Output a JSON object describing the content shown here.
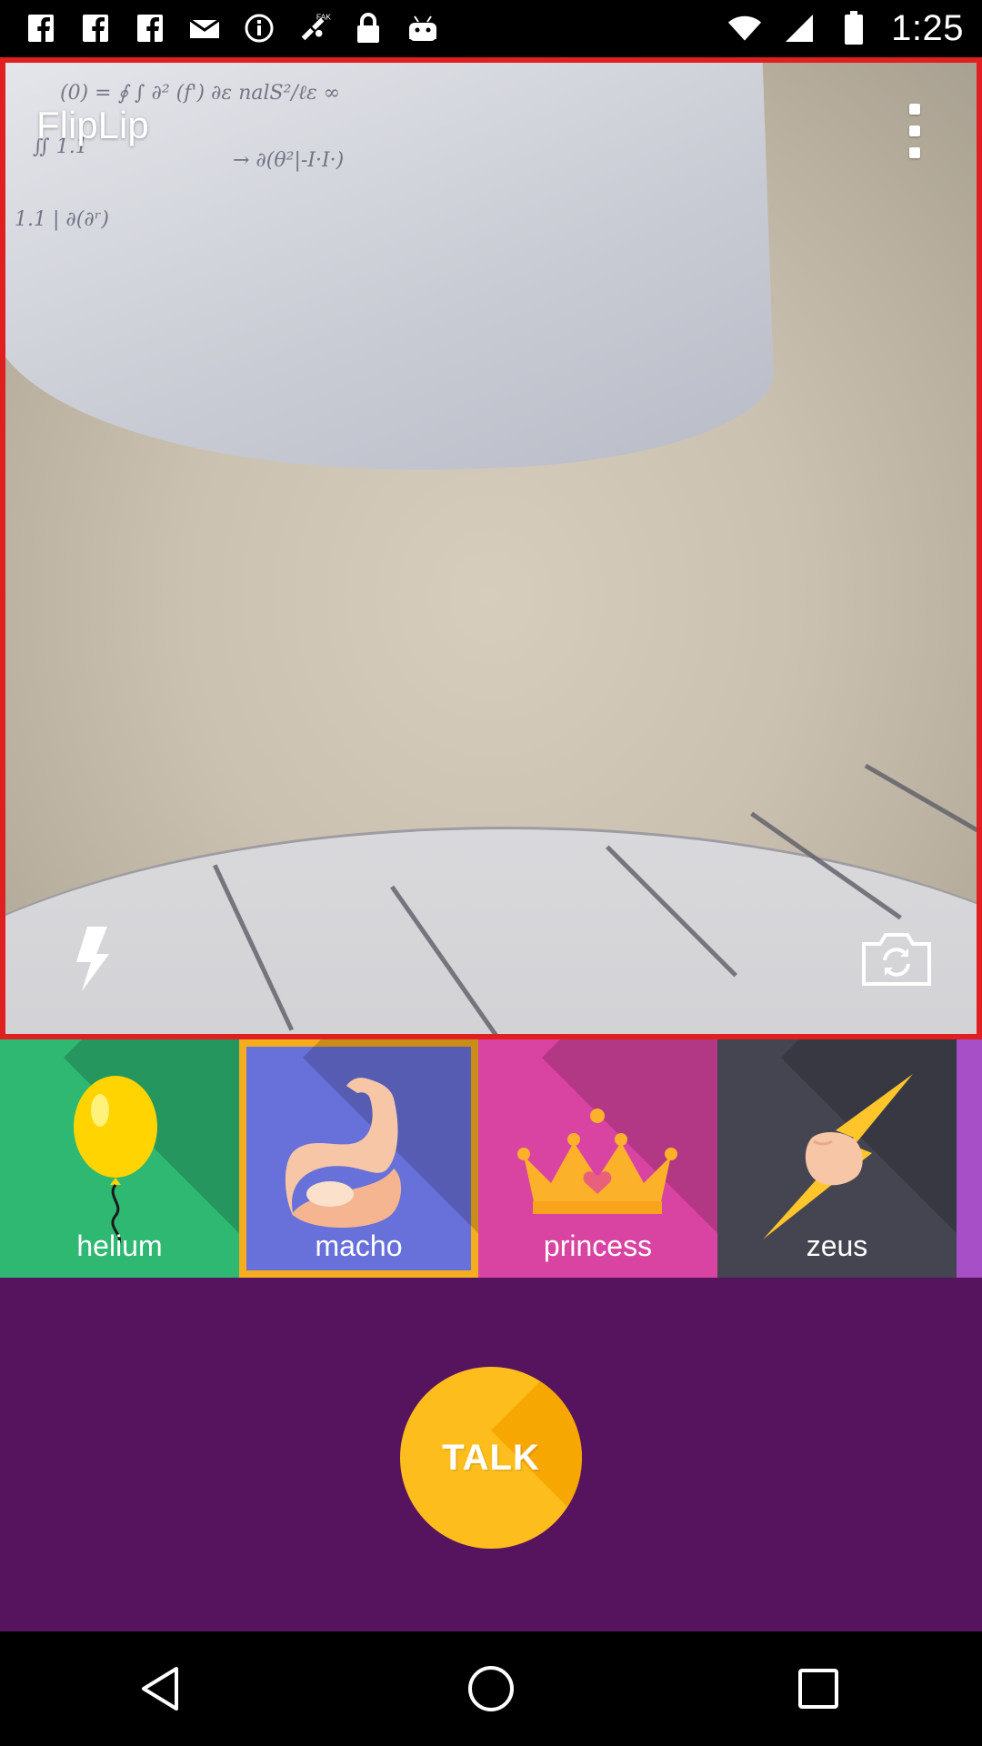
{
  "status_bar": {
    "time": "1:25",
    "icons": [
      "facebook-icon",
      "facebook-icon",
      "facebook-icon",
      "mail-icon",
      "info-icon",
      "fake-gps-icon",
      "lock-icon",
      "android-icon"
    ]
  },
  "app": {
    "title": "FlipLip"
  },
  "voices": [
    {
      "id": "helium",
      "label": "helium",
      "color": "#2eb872",
      "selected": false
    },
    {
      "id": "macho",
      "label": "macho",
      "color": "#6871d9",
      "selected": true
    },
    {
      "id": "princess",
      "label": "princess",
      "color": "#d944a2",
      "selected": false
    },
    {
      "id": "zeus",
      "label": "zeus",
      "color": "#454552",
      "selected": false
    }
  ],
  "talk_button": {
    "label": "TALK"
  },
  "colors": {
    "preview_border": "#e02020",
    "selection_outline": "#f4ad1e",
    "talk_panel": "#56135e",
    "talk_button": "#fcbd1d"
  },
  "nav_bar": {
    "buttons": [
      "back-icon",
      "home-icon",
      "recents-icon"
    ]
  }
}
